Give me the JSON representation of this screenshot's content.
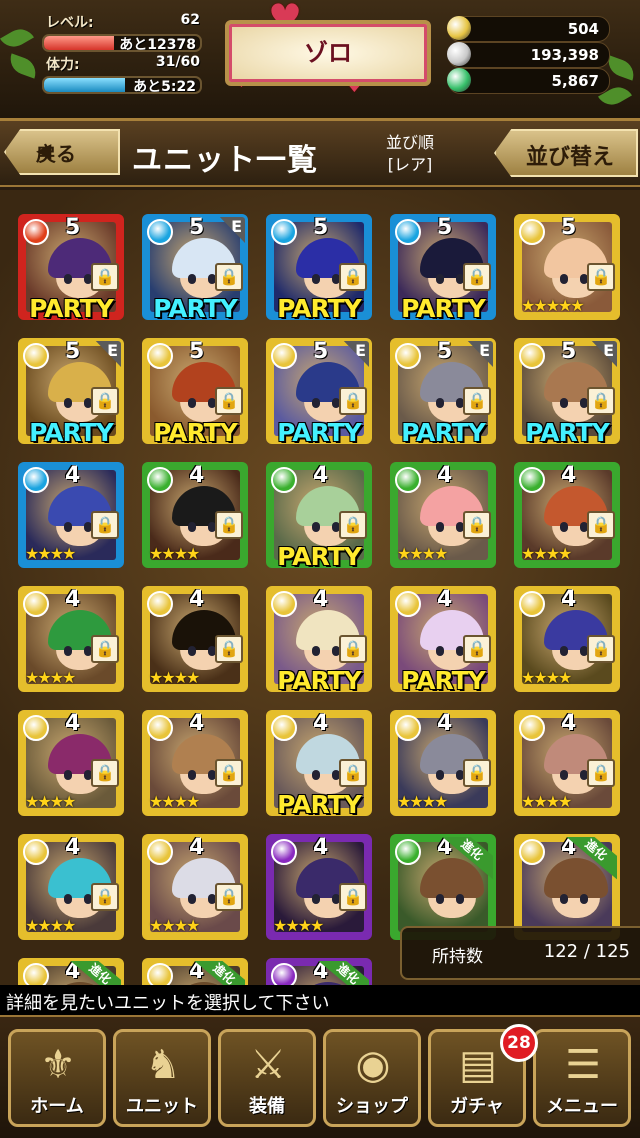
{
  "status": {
    "level_label": "レベル:",
    "level_value": "62",
    "level_next": "あと12378",
    "level_fill": 0.45,
    "stamina_label": "体力:",
    "stamina_value": "31/60",
    "stamina_next": "あと5:22",
    "stamina_fill": 0.52,
    "player_name": "ゾロ",
    "currencies": [
      {
        "name": "gold-coin-icon",
        "value": "504",
        "color": "#e6c443"
      },
      {
        "name": "silver-coin-icon",
        "value": "193,398",
        "color": "#c9c9c9"
      },
      {
        "name": "gem-icon",
        "value": "5,867",
        "color": "#36c06a"
      }
    ]
  },
  "titlebar": {
    "back_label": "戻る",
    "title": "ユニット一覧",
    "sort_label": "並び順",
    "sort_value": "[レア]",
    "sort_button": "並び替え"
  },
  "units": [
    {
      "rarity": "5",
      "element": "fire",
      "frame": "#d0241e",
      "party": "PARTY",
      "party_color": "y",
      "equip_badge": "",
      "stars": "",
      "evolve": "",
      "hair": "#4d2a78",
      "bg": "#6a3a2a"
    },
    {
      "rarity": "5",
      "element": "water",
      "frame": "#1a8fd6",
      "party": "PARTY",
      "party_color": "c",
      "equip_badge": "E",
      "stars": "",
      "evolve": "",
      "hair": "#d8e6f4",
      "bg": "#283e70"
    },
    {
      "rarity": "5",
      "element": "water",
      "frame": "#1a8fd6",
      "party": "PARTY",
      "party_color": "y",
      "equip_badge": "",
      "stars": "",
      "evolve": "",
      "hair": "#2b2ea6",
      "bg": "#1f2a6b"
    },
    {
      "rarity": "5",
      "element": "water",
      "frame": "#1a8fd6",
      "party": "PARTY",
      "party_color": "y",
      "equip_badge": "",
      "stars": "",
      "evolve": "",
      "hair": "#1a1a3a",
      "bg": "#3c2a5a"
    },
    {
      "rarity": "5",
      "element": "light",
      "frame": "#e5be2c",
      "party": "",
      "party_color": "y",
      "equip_badge": "",
      "stars": "★★★★★",
      "evolve": "",
      "hair": "#f2c6a0",
      "bg": "#8a5a3a"
    },
    {
      "rarity": "5",
      "element": "light",
      "frame": "#e5be2c",
      "party": "PARTY",
      "party_color": "c",
      "equip_badge": "E",
      "stars": "",
      "evolve": "",
      "hair": "#d9b04a",
      "bg": "#6a4a1e"
    },
    {
      "rarity": "5",
      "element": "light",
      "frame": "#e5be2c",
      "party": "PARTY",
      "party_color": "y",
      "equip_badge": "",
      "stars": "",
      "evolve": "",
      "hair": "#b2421e",
      "bg": "#8a5a2e"
    },
    {
      "rarity": "5",
      "element": "light",
      "frame": "#e5be2c",
      "party": "PARTY",
      "party_color": "c",
      "equip_badge": "E",
      "stars": "",
      "evolve": "",
      "hair": "#2a3a8a",
      "bg": "#5a5aa0"
    },
    {
      "rarity": "5",
      "element": "light",
      "frame": "#e5be2c",
      "party": "PARTY",
      "party_color": "c",
      "equip_badge": "E",
      "stars": "",
      "evolve": "",
      "hair": "#8a8a9a",
      "bg": "#6a5a4a"
    },
    {
      "rarity": "5",
      "element": "light",
      "frame": "#e5be2c",
      "party": "PARTY",
      "party_color": "c",
      "equip_badge": "E",
      "stars": "",
      "evolve": "",
      "hair": "#a97850",
      "bg": "#5a4a3a"
    },
    {
      "rarity": "4",
      "element": "water",
      "frame": "#1a8fd6",
      "party": "",
      "party_color": "y",
      "equip_badge": "",
      "stars": "★★★★",
      "evolve": "",
      "hair": "#3a4ab0",
      "bg": "#2a2a5a"
    },
    {
      "rarity": "4",
      "element": "wind",
      "frame": "#3aa82e",
      "party": "",
      "party_color": "y",
      "equip_badge": "",
      "stars": "★★★★",
      "evolve": "",
      "hair": "#1a1a1a",
      "bg": "#4a2a1a"
    },
    {
      "rarity": "4",
      "element": "wind",
      "frame": "#3aa82e",
      "party": "PARTY",
      "party_color": "y",
      "equip_badge": "",
      "stars": "",
      "evolve": "",
      "hair": "#a8d09a",
      "bg": "#5a6a4a"
    },
    {
      "rarity": "4",
      "element": "wind",
      "frame": "#3aa82e",
      "party": "",
      "party_color": "y",
      "equip_badge": "",
      "stars": "★★★★",
      "evolve": "",
      "hair": "#f4a2a2",
      "bg": "#6a5a4a"
    },
    {
      "rarity": "4",
      "element": "wind",
      "frame": "#3aa82e",
      "party": "",
      "party_color": "y",
      "equip_badge": "",
      "stars": "★★★★",
      "evolve": "",
      "hair": "#c4582e",
      "bg": "#5a3a2a"
    },
    {
      "rarity": "4",
      "element": "light",
      "frame": "#e5be2c",
      "party": "",
      "party_color": "y",
      "equip_badge": "",
      "stars": "★★★★",
      "evolve": "",
      "hair": "#2e9a3e",
      "bg": "#6a4a2a"
    },
    {
      "rarity": "4",
      "element": "light",
      "frame": "#e5be2c",
      "party": "",
      "party_color": "y",
      "equip_badge": "",
      "stars": "★★★★",
      "evolve": "",
      "hair": "#1a1208",
      "bg": "#4a3018"
    },
    {
      "rarity": "4",
      "element": "light",
      "frame": "#e5be2c",
      "party": "PARTY",
      "party_color": "y",
      "equip_badge": "",
      "stars": "",
      "evolve": "",
      "hair": "#f0e4c0",
      "bg": "#7a5a8a"
    },
    {
      "rarity": "4",
      "element": "light",
      "frame": "#e5be2c",
      "party": "PARTY",
      "party_color": "y",
      "equip_badge": "",
      "stars": "",
      "evolve": "",
      "hair": "#e8d0f0",
      "bg": "#7a4a7a"
    },
    {
      "rarity": "4",
      "element": "light",
      "frame": "#e5be2c",
      "party": "",
      "party_color": "y",
      "equip_badge": "",
      "stars": "★★★★",
      "evolve": "",
      "hair": "#3a3aa0",
      "bg": "#5a4a1e"
    },
    {
      "rarity": "4",
      "element": "light",
      "frame": "#e5be2c",
      "party": "",
      "party_color": "y",
      "equip_badge": "",
      "stars": "★★★★",
      "evolve": "",
      "hair": "#8a2a6a",
      "bg": "#6a5a3a"
    },
    {
      "rarity": "4",
      "element": "light",
      "frame": "#e5be2c",
      "party": "",
      "party_color": "y",
      "equip_badge": "",
      "stars": "★★★★",
      "evolve": "",
      "hair": "#b08050",
      "bg": "#6a4a3a"
    },
    {
      "rarity": "4",
      "element": "light",
      "frame": "#e5be2c",
      "party": "PARTY",
      "party_color": "y",
      "equip_badge": "",
      "stars": "",
      "evolve": "",
      "hair": "#c0d8e0",
      "bg": "#6a5a5a"
    },
    {
      "rarity": "4",
      "element": "light",
      "frame": "#e5be2c",
      "party": "",
      "party_color": "y",
      "equip_badge": "",
      "stars": "★★★★",
      "evolve": "",
      "hair": "#8a8a9a",
      "bg": "#3a3a5a"
    },
    {
      "rarity": "4",
      "element": "light",
      "frame": "#e5be2c",
      "party": "",
      "party_color": "y",
      "equip_badge": "",
      "stars": "★★★★",
      "evolve": "",
      "hair": "#c08a7a",
      "bg": "#6a4a3a"
    },
    {
      "rarity": "4",
      "element": "light",
      "frame": "#e5be2c",
      "party": "",
      "party_color": "y",
      "equip_badge": "",
      "stars": "★★★★",
      "evolve": "",
      "hair": "#3ac0d0",
      "bg": "#4a3a3a"
    },
    {
      "rarity": "4",
      "element": "light",
      "frame": "#e5be2c",
      "party": "",
      "party_color": "y",
      "equip_badge": "",
      "stars": "★★★★",
      "evolve": "",
      "hair": "#dcdce6",
      "bg": "#6a4a4a"
    },
    {
      "rarity": "4",
      "element": "dark",
      "frame": "#7a2ab0",
      "party": "",
      "party_color": "y",
      "equip_badge": "",
      "stars": "★★★★",
      "evolve": "",
      "hair": "#3a2a6a",
      "bg": "#2a1a3a"
    },
    {
      "rarity": "4",
      "element": "wind",
      "frame": "#3aa82e",
      "party": "",
      "party_color": "y",
      "equip_badge": "",
      "stars": "",
      "evolve": "進化",
      "hair": "#7a5030",
      "bg": "#3a5a2a"
    },
    {
      "rarity": "4",
      "element": "light",
      "frame": "#e5be2c",
      "party": "",
      "party_color": "y",
      "equip_badge": "",
      "stars": "",
      "evolve": "進化",
      "hair": "#7a5030",
      "bg": "#4a3a5a"
    },
    {
      "rarity": "4",
      "element": "light",
      "frame": "#e5be2c",
      "party": "",
      "party_color": "y",
      "equip_badge": "",
      "stars": "",
      "evolve": "進化",
      "hair": "#6a4a2a",
      "bg": "#4a3a2a"
    },
    {
      "rarity": "4",
      "element": "light",
      "frame": "#e5be2c",
      "party": "",
      "party_color": "y",
      "equip_badge": "",
      "stars": "",
      "evolve": "進化",
      "hair": "#6a4a2a",
      "bg": "#4a3a2a"
    },
    {
      "rarity": "4",
      "element": "dark",
      "frame": "#7a2ab0",
      "party": "",
      "party_color": "y",
      "equip_badge": "",
      "stars": "",
      "evolve": "進化",
      "hair": "#3a2a6a",
      "bg": "#2a1a3a"
    }
  ],
  "element_colors": {
    "fire": "#e0401a",
    "water": "#1aa4e0",
    "wind": "#3ab02e",
    "light": "#e8c43a",
    "dark": "#8a2ac0"
  },
  "owned": {
    "label": "所持数",
    "count": "122 / 125"
  },
  "message": "詳細を見たいユニットを選択して下さい",
  "nav": [
    {
      "label": "ホーム",
      "icon": "home-icon",
      "glyph": "⚜"
    },
    {
      "label": "ユニット",
      "icon": "unit-icon",
      "glyph": "♞"
    },
    {
      "label": "装備",
      "icon": "equipment-icon",
      "glyph": "⚔"
    },
    {
      "label": "ショップ",
      "icon": "shop-icon",
      "glyph": "◉"
    },
    {
      "label": "ガチャ",
      "icon": "gacha-icon",
      "glyph": "▤"
    },
    {
      "label": "メニュー",
      "icon": "menu-icon",
      "glyph": "☰"
    }
  ],
  "gacha_badge": "28"
}
